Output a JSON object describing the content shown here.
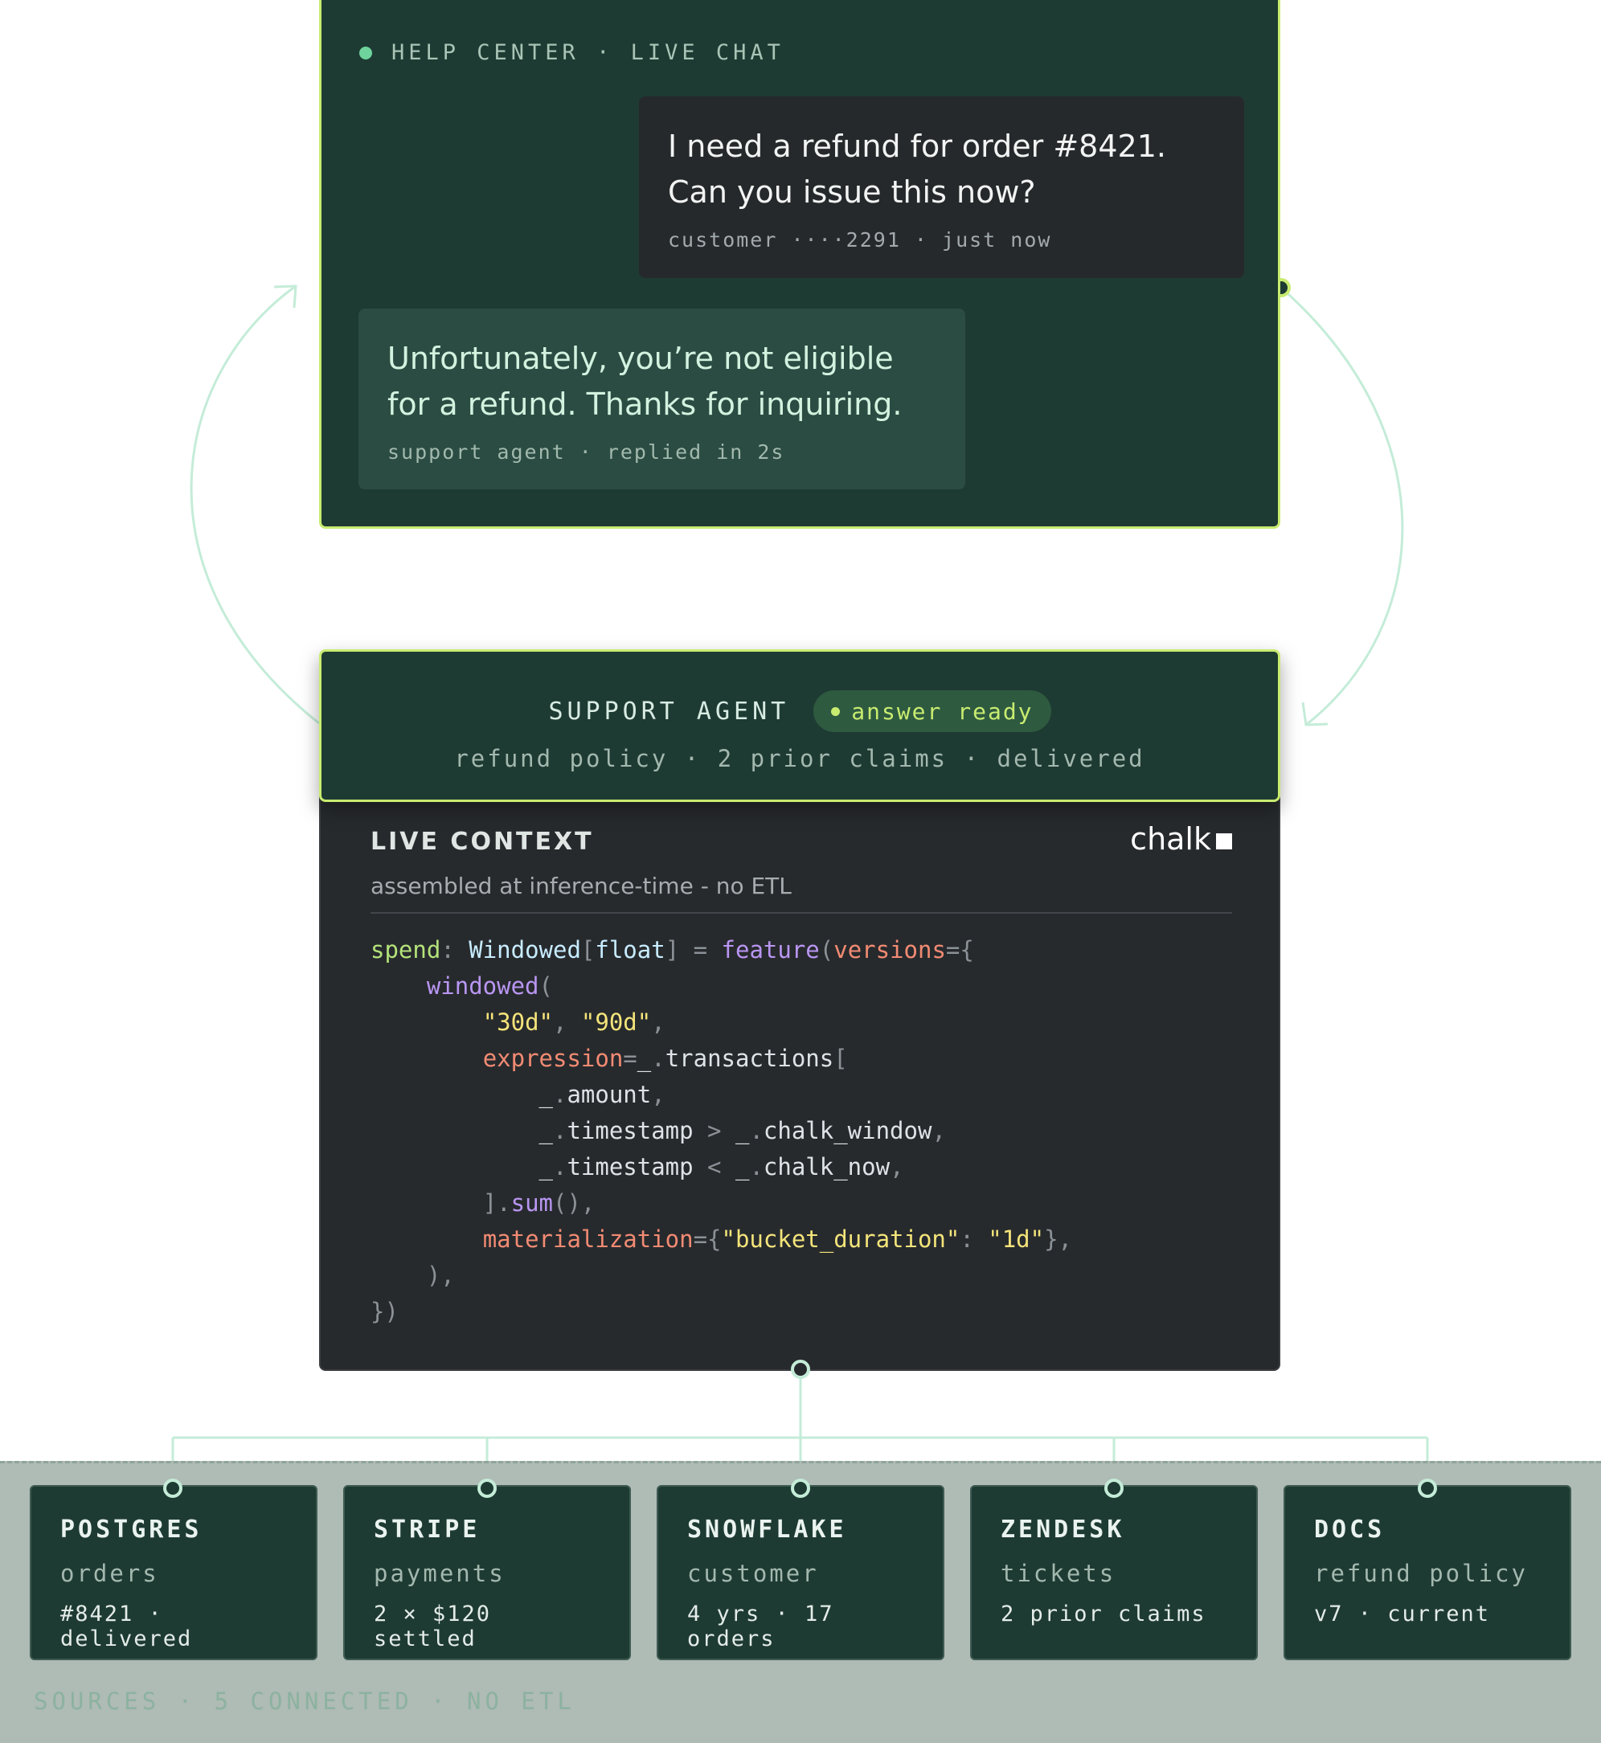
{
  "chat": {
    "header": "HELP CENTER · LIVE CHAT",
    "user_message": "I need a refund for order #8421. Can you issue this now?",
    "user_meta": "customer ····2291 · just now",
    "agent_message": "Unfortunately, you’re not eligible for a refund. Thanks for inquiring.",
    "agent_meta": "support agent · replied in 2s"
  },
  "agent": {
    "title": "SUPPORT AGENT",
    "badge": "answer ready",
    "subtitle": "refund policy · 2 prior claims · delivered"
  },
  "context": {
    "title": "LIVE CONTEXT",
    "brand": "chalk",
    "subtitle": "assembled at inference-time - no ETL",
    "code": [
      [
        [
          "var",
          "spend"
        ],
        [
          "pun",
          ": "
        ],
        [
          "type",
          "Windowed"
        ],
        [
          "pun",
          "["
        ],
        [
          "type",
          "float"
        ],
        [
          "pun",
          "] = "
        ],
        [
          "fn",
          "feature"
        ],
        [
          "pun",
          "("
        ],
        [
          "kw",
          "versions"
        ],
        [
          "pun",
          "={"
        ]
      ],
      [
        [
          "plain",
          "    "
        ],
        [
          "fn",
          "windowed"
        ],
        [
          "pun",
          "("
        ]
      ],
      [
        [
          "plain",
          "        "
        ],
        [
          "str",
          "\"30d\""
        ],
        [
          "pun",
          ", "
        ],
        [
          "str",
          "\"90d\""
        ],
        [
          "pun",
          ","
        ]
      ],
      [
        [
          "plain",
          "        "
        ],
        [
          "kw",
          "expression"
        ],
        [
          "pun",
          "="
        ],
        [
          "plain",
          "_"
        ],
        [
          "pun",
          "."
        ],
        [
          "plain",
          "transactions"
        ],
        [
          "pun",
          "["
        ]
      ],
      [
        [
          "plain",
          "            _"
        ],
        [
          "pun",
          "."
        ],
        [
          "plain",
          "amount"
        ],
        [
          "pun",
          ","
        ]
      ],
      [
        [
          "plain",
          "            _"
        ],
        [
          "pun",
          "."
        ],
        [
          "plain",
          "timestamp"
        ],
        [
          "pun",
          " > "
        ],
        [
          "plain",
          "_"
        ],
        [
          "pun",
          "."
        ],
        [
          "plain",
          "chalk_window"
        ],
        [
          "pun",
          ","
        ]
      ],
      [
        [
          "plain",
          "            _"
        ],
        [
          "pun",
          "."
        ],
        [
          "plain",
          "timestamp"
        ],
        [
          "pun",
          " < "
        ],
        [
          "plain",
          "_"
        ],
        [
          "pun",
          "."
        ],
        [
          "plain",
          "chalk_now"
        ],
        [
          "pun",
          ","
        ]
      ],
      [
        [
          "plain",
          "        "
        ],
        [
          "pun",
          "]."
        ],
        [
          "fn",
          "sum"
        ],
        [
          "pun",
          "(),"
        ]
      ],
      [
        [
          "plain",
          "        "
        ],
        [
          "kw",
          "materialization"
        ],
        [
          "pun",
          "={"
        ],
        [
          "str",
          "\"bucket_duration\""
        ],
        [
          "pun",
          ": "
        ],
        [
          "str",
          "\"1d\""
        ],
        [
          "pun",
          "},"
        ]
      ],
      [
        [
          "plain",
          "    "
        ],
        [
          "pun",
          "),"
        ]
      ],
      [
        [
          "pun",
          "})"
        ]
      ]
    ]
  },
  "sources": {
    "items": [
      {
        "name": "POSTGRES",
        "sub": "orders",
        "detail": "#8421 · delivered"
      },
      {
        "name": "STRIPE",
        "sub": "payments",
        "detail": "2 × $120 settled"
      },
      {
        "name": "SNOWFLAKE",
        "sub": "customer",
        "detail": "4 yrs · 17 orders"
      },
      {
        "name": "ZENDESK",
        "sub": "tickets",
        "detail": "2 prior claims"
      },
      {
        "name": "DOCS",
        "sub": "refund policy",
        "detail": "v7 · current"
      }
    ],
    "footer": "SOURCES · 5 CONNECTED · NO ETL"
  },
  "colors": {
    "panel": "#1e3b33",
    "accent": "#c8ec70",
    "wire": "#c4ecd8",
    "code_bg": "#272a2d",
    "sources_bg": "#afbbb5"
  }
}
